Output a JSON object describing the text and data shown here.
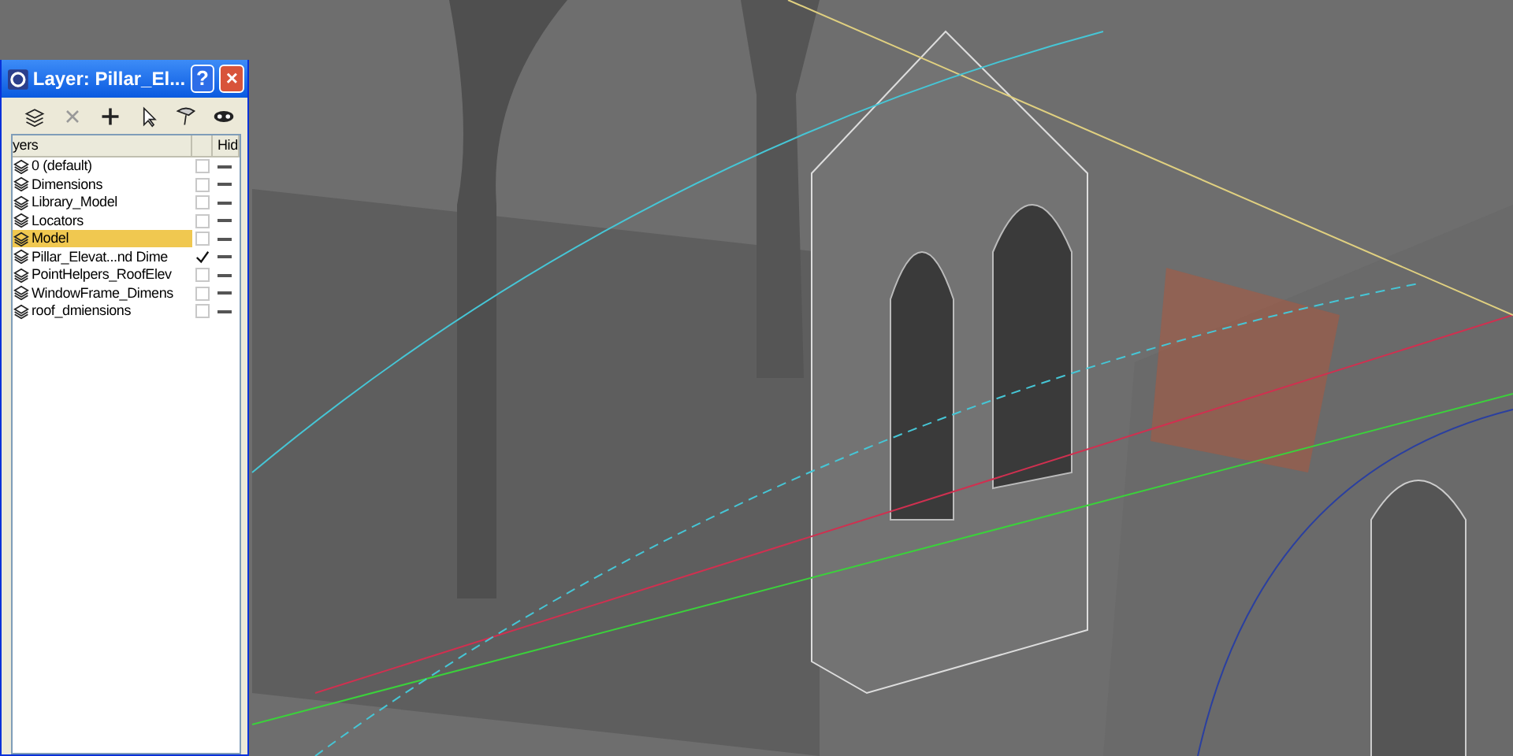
{
  "dialog": {
    "title": "Layer: Pillar_El...",
    "help_button": "?",
    "close_button": "×"
  },
  "layer_list": {
    "columns": [
      "yers",
      "",
      "Hid"
    ],
    "rows": [
      {
        "name": "0 (default)",
        "selected": false,
        "current": false
      },
      {
        "name": "Dimensions",
        "selected": false,
        "current": false
      },
      {
        "name": "Library_Model",
        "selected": false,
        "current": false
      },
      {
        "name": "Locators",
        "selected": false,
        "current": false
      },
      {
        "name": "Model",
        "selected": true,
        "current": false
      },
      {
        "name": "Pillar_Elevat...nd Dime",
        "selected": false,
        "current": true
      },
      {
        "name": "PointHelpers_RoofElev",
        "selected": false,
        "current": false
      },
      {
        "name": "WindowFrame_Dimens",
        "selected": false,
        "current": false
      },
      {
        "name": "roof_dmiensions",
        "selected": false,
        "current": false
      }
    ]
  }
}
